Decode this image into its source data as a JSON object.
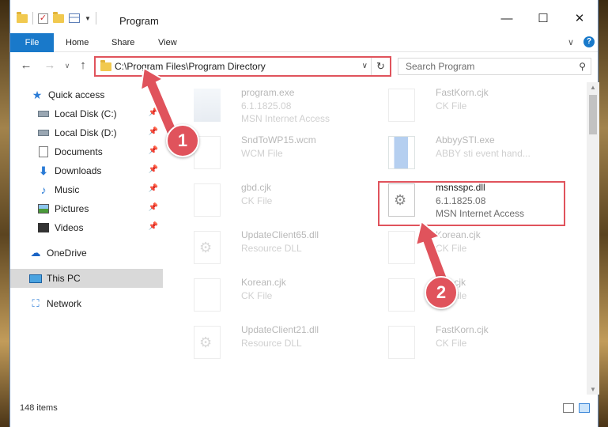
{
  "window": {
    "title": "Program",
    "controls": {
      "minimize": "—",
      "maximize": "☐",
      "close": "✕"
    }
  },
  "ribbon": {
    "tabs": [
      "File",
      "Home",
      "Share",
      "View"
    ],
    "help": "?",
    "expand": "∨"
  },
  "nav_buttons": {
    "back": "←",
    "forward": "→",
    "recent": "∨",
    "up": "↑"
  },
  "address": {
    "path": "C:\\Program Files\\Program Directory",
    "dropdown": "∨",
    "refresh": "↻"
  },
  "search": {
    "placeholder": "Search Program",
    "icon": "⚲"
  },
  "sidebar": {
    "items": [
      {
        "label": "Quick access",
        "icon": "star-icon"
      },
      {
        "label": "Local Disk (C:)",
        "icon": "disk-icon",
        "pinned": true
      },
      {
        "label": "Local Disk (D:)",
        "icon": "disk-icon",
        "pinned": true
      },
      {
        "label": "Documents",
        "icon": "documents-icon",
        "pinned": true
      },
      {
        "label": "Downloads",
        "icon": "download-icon",
        "pinned": true
      },
      {
        "label": "Music",
        "icon": "music-icon",
        "pinned": true
      },
      {
        "label": "Pictures",
        "icon": "pictures-icon",
        "pinned": true
      },
      {
        "label": "Videos",
        "icon": "videos-icon",
        "pinned": true
      },
      {
        "label": "OneDrive",
        "icon": "cloud-icon"
      },
      {
        "label": "This PC",
        "icon": "computer-icon",
        "selected": true
      },
      {
        "label": "Network",
        "icon": "network-icon"
      }
    ],
    "pin_glyph": "📌"
  },
  "files": [
    {
      "name": "program.exe",
      "sub1": "6.1.1825.08",
      "sub2": "MSN Internet Access",
      "icon": "application-icon"
    },
    {
      "name": "FastKorn.cjk",
      "sub1": "CK File",
      "sub2": "",
      "icon": "file-icon"
    },
    {
      "name": "SndToWP15.wcm",
      "sub1": "WCM File",
      "sub2": "",
      "icon": "file-icon"
    },
    {
      "name": "AbbyySTI.exe",
      "sub1": "ABBY sti event hand...",
      "sub2": "",
      "icon": "executable-icon"
    },
    {
      "name": "gbd.cjk",
      "sub1": "CK File",
      "sub2": "",
      "icon": "file-icon"
    },
    {
      "name": "msnsspc.dll",
      "sub1": "6.1.1825.08",
      "sub2": "MSN Internet Access",
      "icon": "dll-gear-icon",
      "highlighted": true
    },
    {
      "name": "UpdateClient65.dll",
      "sub1": "Resource DLL",
      "sub2": "",
      "icon": "dll-gear-icon"
    },
    {
      "name": "Korean.cjk",
      "sub1": "CK File",
      "sub2": "",
      "icon": "file-icon"
    },
    {
      "name": "Korean.cjk",
      "sub1": "CK File",
      "sub2": "",
      "icon": "file-icon"
    },
    {
      "name": "gbd.cjk",
      "sub1": "CK File",
      "sub2": "",
      "icon": "file-icon"
    },
    {
      "name": "UpdateClient21.dll",
      "sub1": "Resource DLL",
      "sub2": "",
      "icon": "dll-gear-icon"
    },
    {
      "name": "FastKorn.cjk",
      "sub1": "CK File",
      "sub2": "",
      "icon": "file-icon"
    }
  ],
  "status": {
    "item_count": "148 items"
  },
  "callouts": {
    "one": "1",
    "two": "2",
    "color": "#e0535c"
  },
  "accent": "#1979ca"
}
